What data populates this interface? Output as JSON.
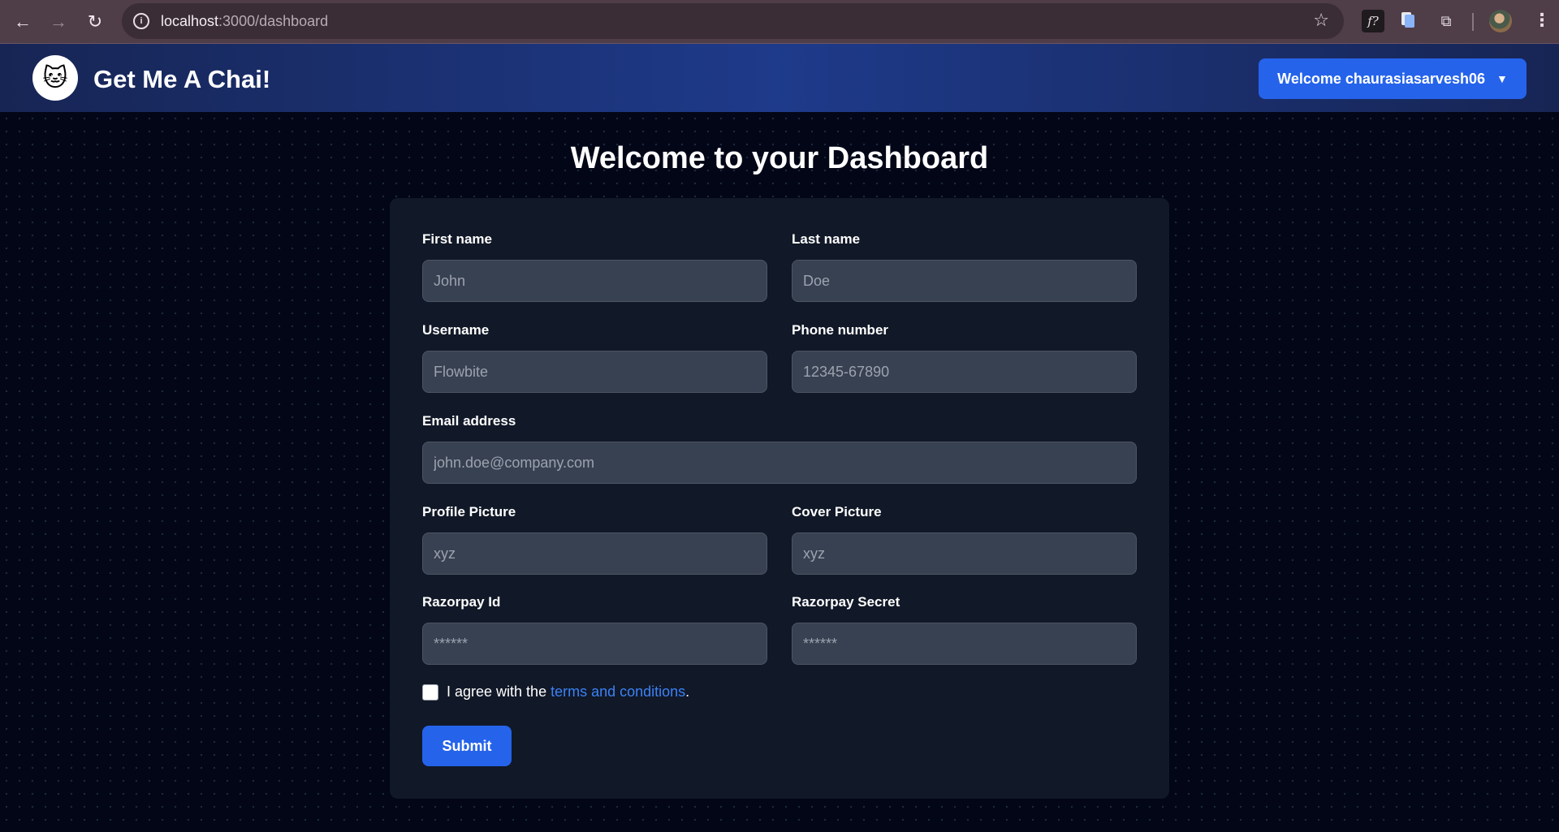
{
  "browser": {
    "url_host": "localhost",
    "url_path": ":3000/dashboard",
    "ext_fx_label": "f?"
  },
  "navbar": {
    "brand": "Get Me A Chai!",
    "logo_glyph": "🐱",
    "welcome_label": "Welcome chaurasiasarvesh06"
  },
  "page": {
    "title": "Welcome to your Dashboard"
  },
  "form": {
    "first_name": {
      "label": "First name",
      "placeholder": "John"
    },
    "last_name": {
      "label": "Last name",
      "placeholder": "Doe"
    },
    "username": {
      "label": "Username",
      "placeholder": "Flowbite"
    },
    "phone": {
      "label": "Phone number",
      "placeholder": "12345-67890"
    },
    "email": {
      "label": "Email address",
      "placeholder": "john.doe@company.com"
    },
    "profile_picture": {
      "label": "Profile Picture",
      "placeholder": "xyz"
    },
    "cover_picture": {
      "label": "Cover Picture",
      "placeholder": "xyz"
    },
    "razorpay_id": {
      "label": "Razorpay Id",
      "placeholder": "******"
    },
    "razorpay_secret": {
      "label": "Razorpay Secret",
      "placeholder": "******"
    },
    "agree_prefix": "I agree with the ",
    "agree_link": "terms and conditions",
    "agree_suffix": ".",
    "submit_label": "Submit"
  },
  "colors": {
    "accent": "#2563eb",
    "card_bg": "#111827",
    "input_bg": "#374151",
    "link": "#3b82f6"
  }
}
